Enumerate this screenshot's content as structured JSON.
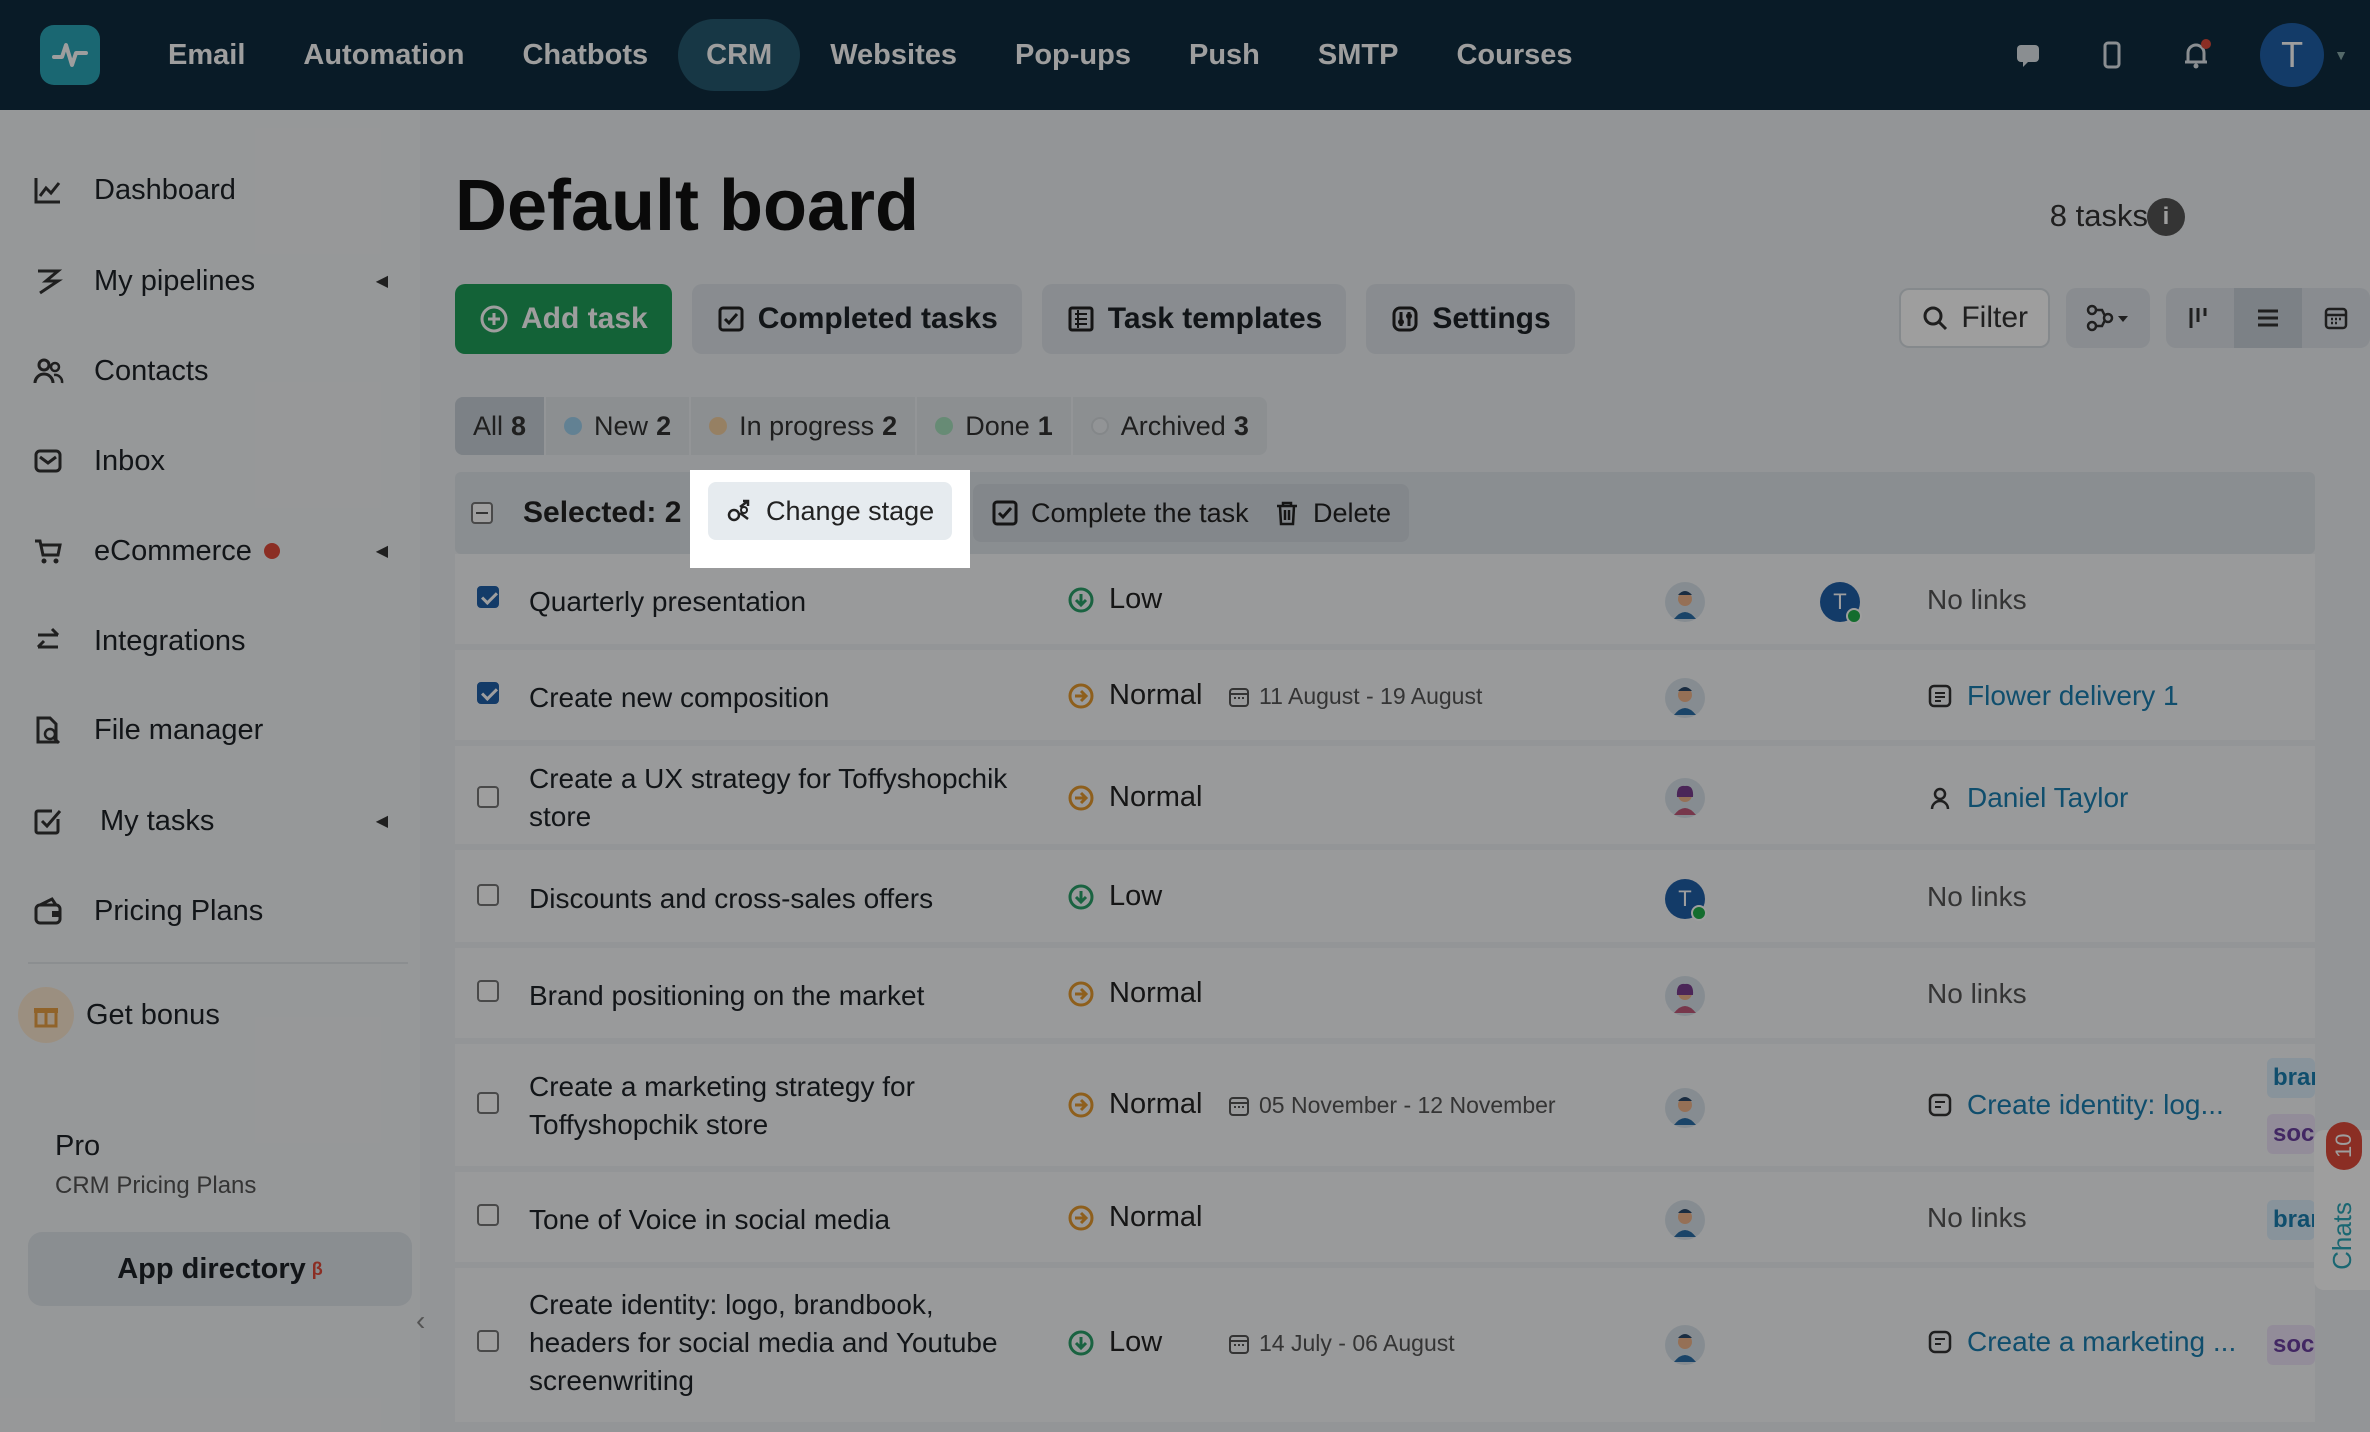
{
  "nav": {
    "items": [
      "Email",
      "Automation",
      "Chatbots",
      "CRM",
      "Websites",
      "Pop-ups",
      "Push",
      "SMTP",
      "Courses"
    ],
    "active": "CRM",
    "user_initial": "T"
  },
  "sidebar": {
    "items": [
      {
        "label": "Dashboard"
      },
      {
        "label": "My pipelines"
      },
      {
        "label": "Contacts"
      },
      {
        "label": "Inbox"
      },
      {
        "label": "eCommerce"
      },
      {
        "label": "Integrations"
      },
      {
        "label": "File manager"
      },
      {
        "label": "My tasks"
      },
      {
        "label": "Pricing Plans"
      },
      {
        "label": "Get bonus"
      }
    ],
    "plan_name": "Pro",
    "plan_sub": "CRM Pricing Plans",
    "app_directory": "App directory",
    "beta": "β"
  },
  "board": {
    "title": "Default board",
    "task_count": "8 tasks",
    "buttons": {
      "add_task": "Add task",
      "completed_tasks": "Completed tasks",
      "task_templates": "Task templates",
      "settings": "Settings",
      "filter": "Filter"
    },
    "stages": [
      {
        "label": "All",
        "count": "8",
        "color": ""
      },
      {
        "label": "New",
        "count": "2",
        "color": "#9fd0ee"
      },
      {
        "label": "In progress",
        "count": "2",
        "color": "#f3cfa0"
      },
      {
        "label": "Done",
        "count": "1",
        "color": "#a6e0bd"
      },
      {
        "label": "Archived",
        "count": "3",
        "color": "#e2e6ea"
      }
    ],
    "selection": {
      "label": "Selected: 2",
      "change_stage": "Change stage",
      "complete": "Complete the task",
      "delete": "Delete"
    },
    "rows": [
      {
        "title": "Quarterly presentation",
        "priority": "Low",
        "dates": "",
        "link": "No links",
        "checked": true
      },
      {
        "title": "Create new composition",
        "priority": "Normal",
        "dates": "11 August  - 19 August",
        "link": "Flower delivery 1",
        "checked": true
      },
      {
        "title": "Create a UX strategy for Toffyshopchik store",
        "priority": "Normal",
        "dates": "",
        "link": "Daniel Taylor",
        "checked": false
      },
      {
        "title": "Discounts and cross-sales offers",
        "priority": "Low",
        "dates": "",
        "link": "No links",
        "checked": false
      },
      {
        "title": "Brand positioning on the market",
        "priority": "Normal",
        "dates": "",
        "link": "No links",
        "checked": false
      },
      {
        "title": "Create a marketing strategy for Toffyshopchik store",
        "priority": "Normal",
        "dates": "05 November  - 12 November",
        "link": "Create identity: log...",
        "checked": false
      },
      {
        "title": "Tone of Voice in social media",
        "priority": "Normal",
        "dates": "",
        "link": "No links",
        "checked": false
      },
      {
        "title": "Create identity: logo, brandbook, headers for social media and Youtube screenwriting",
        "priority": "Low",
        "dates": "14 July  - 06 August",
        "link": "Create a marketing ...",
        "checked": false
      }
    ],
    "tags": {
      "brand": "brand",
      "soc": "social"
    }
  },
  "chats": {
    "label": "Chats",
    "badge": "10"
  },
  "colors": {
    "topbar": "#0f2d3f",
    "primary": "#1f9e5a",
    "accent": "#2aa6b8",
    "link": "#1a7fb0"
  }
}
